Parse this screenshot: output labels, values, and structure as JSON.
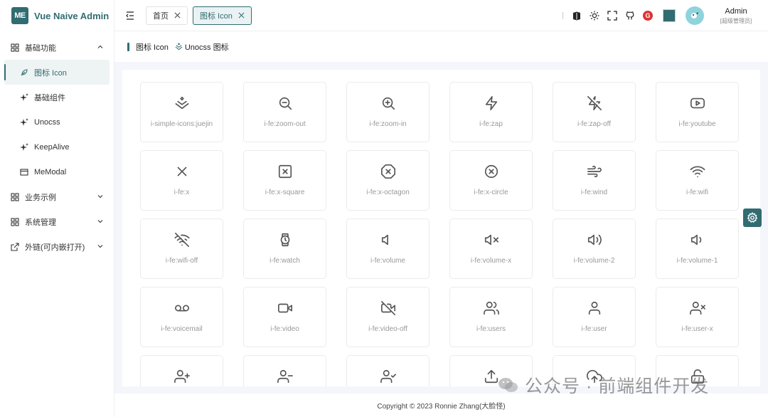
{
  "app": {
    "logo_text": "ME",
    "title": "Vue Naive Admin"
  },
  "sidebar": {
    "items": [
      {
        "label": "基础功能",
        "icon": "grid-icon",
        "expanded": true
      },
      {
        "label": "图标 Icon",
        "icon": "feather-icon",
        "active": true
      },
      {
        "label": "基础组件",
        "icon": "sparkle-icon"
      },
      {
        "label": "Unocss",
        "icon": "sparkle-icon"
      },
      {
        "label": "KeepAlive",
        "icon": "sparkle-icon"
      },
      {
        "label": "MeModal",
        "icon": "window-icon"
      },
      {
        "label": "业务示例",
        "icon": "grid-icon",
        "expanded": false
      },
      {
        "label": "系统管理",
        "icon": "grid-icon",
        "expanded": false
      },
      {
        "label": "外链(可内嵌打开)",
        "icon": "external-link-icon",
        "expanded": false
      }
    ]
  },
  "header": {
    "tabs": [
      {
        "label": "首页",
        "active": false
      },
      {
        "label": "图标 Icon",
        "active": true
      }
    ],
    "theme_color": "#316c72",
    "user": {
      "name": "Admin",
      "role": "[超级管理员]"
    }
  },
  "page": {
    "title": "图标 Icon",
    "link_label": "Unocss 图标"
  },
  "icons": [
    {
      "name": "i-simple-icons:juejin",
      "semantic": "juejin-icon"
    },
    {
      "name": "i-fe:zoom-out",
      "semantic": "zoom-out-icon"
    },
    {
      "name": "i-fe:zoom-in",
      "semantic": "zoom-in-icon"
    },
    {
      "name": "i-fe:zap",
      "semantic": "zap-icon"
    },
    {
      "name": "i-fe:zap-off",
      "semantic": "zap-off-icon"
    },
    {
      "name": "i-fe:youtube",
      "semantic": "youtube-icon"
    },
    {
      "name": "i-fe:x",
      "semantic": "x-icon"
    },
    {
      "name": "i-fe:x-square",
      "semantic": "x-square-icon"
    },
    {
      "name": "i-fe:x-octagon",
      "semantic": "x-octagon-icon"
    },
    {
      "name": "i-fe:x-circle",
      "semantic": "x-circle-icon"
    },
    {
      "name": "i-fe:wind",
      "semantic": "wind-icon"
    },
    {
      "name": "i-fe:wifi",
      "semantic": "wifi-icon"
    },
    {
      "name": "i-fe:wifi-off",
      "semantic": "wifi-off-icon"
    },
    {
      "name": "i-fe:watch",
      "semantic": "watch-icon"
    },
    {
      "name": "i-fe:volume",
      "semantic": "volume-icon"
    },
    {
      "name": "i-fe:volume-x",
      "semantic": "volume-x-icon"
    },
    {
      "name": "i-fe:volume-2",
      "semantic": "volume-2-icon"
    },
    {
      "name": "i-fe:volume-1",
      "semantic": "volume-1-icon"
    },
    {
      "name": "i-fe:voicemail",
      "semantic": "voicemail-icon"
    },
    {
      "name": "i-fe:video",
      "semantic": "video-icon"
    },
    {
      "name": "i-fe:video-off",
      "semantic": "video-off-icon"
    },
    {
      "name": "i-fe:users",
      "semantic": "users-icon"
    },
    {
      "name": "i-fe:user",
      "semantic": "user-icon"
    },
    {
      "name": "i-fe:user-x",
      "semantic": "user-x-icon"
    },
    {
      "name": "",
      "semantic": "user-plus-icon"
    },
    {
      "name": "",
      "semantic": "user-minus-icon"
    },
    {
      "name": "",
      "semantic": "user-check-icon"
    },
    {
      "name": "",
      "semantic": "upload-icon"
    },
    {
      "name": "",
      "semantic": "upload-cloud-icon"
    },
    {
      "name": "",
      "semantic": "unlock-icon"
    }
  ],
  "footer": {
    "copyright": "Copyright © 2023 Ronnie Zhang(大脸怪)"
  },
  "watermark": {
    "text": "公众号 · 前端组件开发"
  }
}
